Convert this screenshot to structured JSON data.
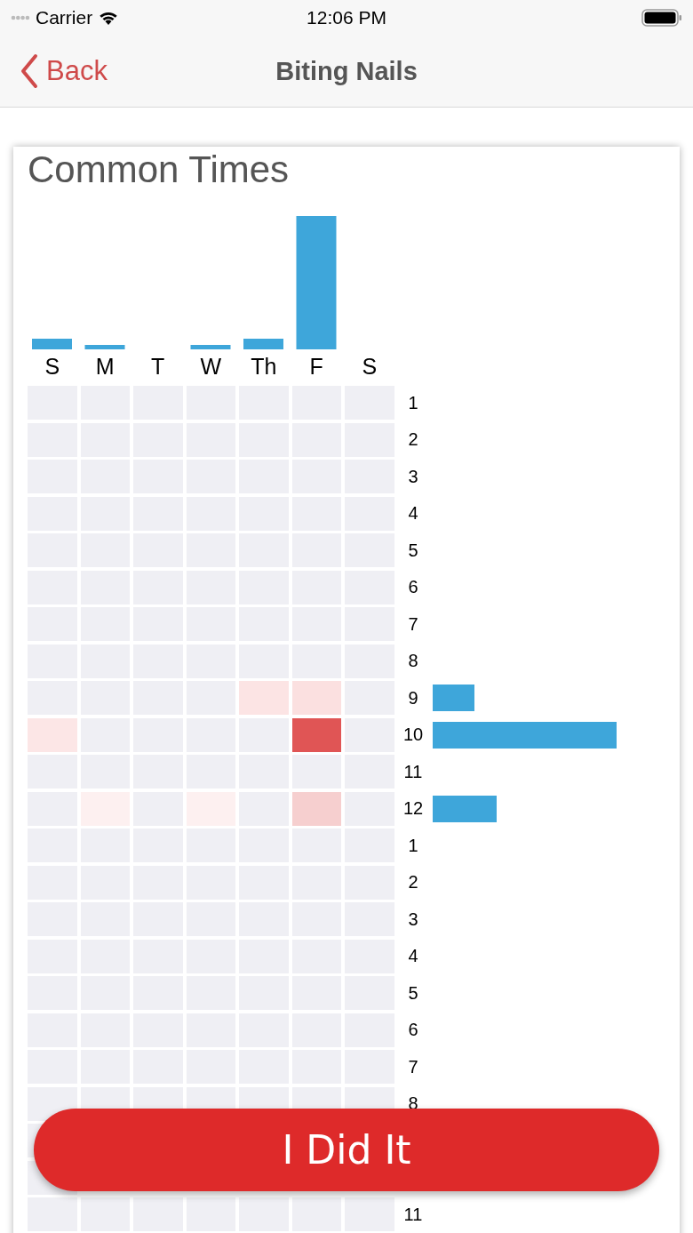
{
  "status_bar": {
    "carrier": "Carrier",
    "time": "12:06 PM"
  },
  "nav": {
    "back": "Back",
    "title": "Biting Nails"
  },
  "card": {
    "title": "Common Times",
    "days": [
      {
        "label": "S"
      },
      {
        "label": "M"
      },
      {
        "label": "T"
      },
      {
        "label": "W"
      },
      {
        "label": "Th"
      },
      {
        "label": "F"
      },
      {
        "label": "S"
      }
    ],
    "hours": [
      {
        "label": "1",
        "cells": [
          {
            "color": "#efeff4"
          },
          {
            "color": "#efeff4"
          },
          {
            "color": "#efeff4"
          },
          {
            "color": "#efeff4"
          },
          {
            "color": "#efeff4"
          },
          {
            "color": "#efeff4"
          },
          {
            "color": "#efeff4"
          }
        ]
      },
      {
        "label": "2",
        "cells": [
          {
            "color": "#efeff4"
          },
          {
            "color": "#efeff4"
          },
          {
            "color": "#efeff4"
          },
          {
            "color": "#efeff4"
          },
          {
            "color": "#efeff4"
          },
          {
            "color": "#efeff4"
          },
          {
            "color": "#efeff4"
          }
        ]
      },
      {
        "label": "3",
        "cells": [
          {
            "color": "#efeff4"
          },
          {
            "color": "#efeff4"
          },
          {
            "color": "#efeff4"
          },
          {
            "color": "#efeff4"
          },
          {
            "color": "#efeff4"
          },
          {
            "color": "#efeff4"
          },
          {
            "color": "#efeff4"
          }
        ]
      },
      {
        "label": "4",
        "cells": [
          {
            "color": "#efeff4"
          },
          {
            "color": "#efeff4"
          },
          {
            "color": "#efeff4"
          },
          {
            "color": "#efeff4"
          },
          {
            "color": "#efeff4"
          },
          {
            "color": "#efeff4"
          },
          {
            "color": "#efeff4"
          }
        ]
      },
      {
        "label": "5",
        "cells": [
          {
            "color": "#efeff4"
          },
          {
            "color": "#efeff4"
          },
          {
            "color": "#efeff4"
          },
          {
            "color": "#efeff4"
          },
          {
            "color": "#efeff4"
          },
          {
            "color": "#efeff4"
          },
          {
            "color": "#efeff4"
          }
        ]
      },
      {
        "label": "6",
        "cells": [
          {
            "color": "#efeff4"
          },
          {
            "color": "#efeff4"
          },
          {
            "color": "#efeff4"
          },
          {
            "color": "#efeff4"
          },
          {
            "color": "#efeff4"
          },
          {
            "color": "#efeff4"
          },
          {
            "color": "#efeff4"
          }
        ]
      },
      {
        "label": "7",
        "cells": [
          {
            "color": "#efeff4"
          },
          {
            "color": "#efeff4"
          },
          {
            "color": "#efeff4"
          },
          {
            "color": "#efeff4"
          },
          {
            "color": "#efeff4"
          },
          {
            "color": "#efeff4"
          },
          {
            "color": "#efeff4"
          }
        ]
      },
      {
        "label": "8",
        "cells": [
          {
            "color": "#efeff4"
          },
          {
            "color": "#efeff4"
          },
          {
            "color": "#efeff4"
          },
          {
            "color": "#efeff4"
          },
          {
            "color": "#efeff4"
          },
          {
            "color": "#efeff4"
          },
          {
            "color": "#efeff4"
          }
        ]
      },
      {
        "label": "9",
        "cells": [
          {
            "color": "#efeff4"
          },
          {
            "color": "#efeff4"
          },
          {
            "color": "#efeff4"
          },
          {
            "color": "#efeff4"
          },
          {
            "color": "#fce4e4"
          },
          {
            "color": "#fbe0e0"
          },
          {
            "color": "#efeff4"
          }
        ]
      },
      {
        "label": "10",
        "cells": [
          {
            "color": "#fce6e6"
          },
          {
            "color": "#efeff4"
          },
          {
            "color": "#efeff4"
          },
          {
            "color": "#efeff4"
          },
          {
            "color": "#efeff4"
          },
          {
            "color": "#e05555"
          },
          {
            "color": "#efeff4"
          }
        ]
      },
      {
        "label": "11",
        "cells": [
          {
            "color": "#efeff4"
          },
          {
            "color": "#efeff4"
          },
          {
            "color": "#efeff4"
          },
          {
            "color": "#efeff4"
          },
          {
            "color": "#efeff4"
          },
          {
            "color": "#efeff4"
          },
          {
            "color": "#efeff4"
          }
        ]
      },
      {
        "label": "12",
        "cells": [
          {
            "color": "#efeff4"
          },
          {
            "color": "#fdf0f0"
          },
          {
            "color": "#efeff4"
          },
          {
            "color": "#fdf0f0"
          },
          {
            "color": "#efeff4"
          },
          {
            "color": "#f6cfcf"
          },
          {
            "color": "#efeff4"
          }
        ]
      },
      {
        "label": "1",
        "cells": [
          {
            "color": "#efeff4"
          },
          {
            "color": "#efeff4"
          },
          {
            "color": "#efeff4"
          },
          {
            "color": "#efeff4"
          },
          {
            "color": "#efeff4"
          },
          {
            "color": "#efeff4"
          },
          {
            "color": "#efeff4"
          }
        ]
      },
      {
        "label": "2",
        "cells": [
          {
            "color": "#efeff4"
          },
          {
            "color": "#efeff4"
          },
          {
            "color": "#efeff4"
          },
          {
            "color": "#efeff4"
          },
          {
            "color": "#efeff4"
          },
          {
            "color": "#efeff4"
          },
          {
            "color": "#efeff4"
          }
        ]
      },
      {
        "label": "3",
        "cells": [
          {
            "color": "#efeff4"
          },
          {
            "color": "#efeff4"
          },
          {
            "color": "#efeff4"
          },
          {
            "color": "#efeff4"
          },
          {
            "color": "#efeff4"
          },
          {
            "color": "#efeff4"
          },
          {
            "color": "#efeff4"
          }
        ]
      },
      {
        "label": "4",
        "cells": [
          {
            "color": "#efeff4"
          },
          {
            "color": "#efeff4"
          },
          {
            "color": "#efeff4"
          },
          {
            "color": "#efeff4"
          },
          {
            "color": "#efeff4"
          },
          {
            "color": "#efeff4"
          },
          {
            "color": "#efeff4"
          }
        ]
      },
      {
        "label": "5",
        "cells": [
          {
            "color": "#efeff4"
          },
          {
            "color": "#efeff4"
          },
          {
            "color": "#efeff4"
          },
          {
            "color": "#efeff4"
          },
          {
            "color": "#efeff4"
          },
          {
            "color": "#efeff4"
          },
          {
            "color": "#efeff4"
          }
        ]
      },
      {
        "label": "6",
        "cells": [
          {
            "color": "#efeff4"
          },
          {
            "color": "#efeff4"
          },
          {
            "color": "#efeff4"
          },
          {
            "color": "#efeff4"
          },
          {
            "color": "#efeff4"
          },
          {
            "color": "#efeff4"
          },
          {
            "color": "#efeff4"
          }
        ]
      },
      {
        "label": "7",
        "cells": [
          {
            "color": "#efeff4"
          },
          {
            "color": "#efeff4"
          },
          {
            "color": "#efeff4"
          },
          {
            "color": "#efeff4"
          },
          {
            "color": "#efeff4"
          },
          {
            "color": "#efeff4"
          },
          {
            "color": "#efeff4"
          }
        ]
      },
      {
        "label": "8",
        "cells": [
          {
            "color": "#efeff4"
          },
          {
            "color": "#efeff4"
          },
          {
            "color": "#efeff4"
          },
          {
            "color": "#efeff4"
          },
          {
            "color": "#efeff4"
          },
          {
            "color": "#efeff4"
          },
          {
            "color": "#efeff4"
          }
        ]
      },
      {
        "cells": [
          {
            "color": "#efeff4"
          }
        ]
      },
      {
        "cells": [
          {
            "color": "#efeff4"
          }
        ]
      },
      {
        "label": "11",
        "cells": [
          {
            "color": "#efeff4"
          },
          {
            "color": "#efeff4"
          },
          {
            "color": "#efeff4"
          },
          {
            "color": "#efeff4"
          },
          {
            "color": "#efeff4"
          },
          {
            "color": "#efeff4"
          },
          {
            "color": "#efeff4"
          }
        ]
      }
    ]
  },
  "action_button": {
    "label": "I Did It"
  }
}
